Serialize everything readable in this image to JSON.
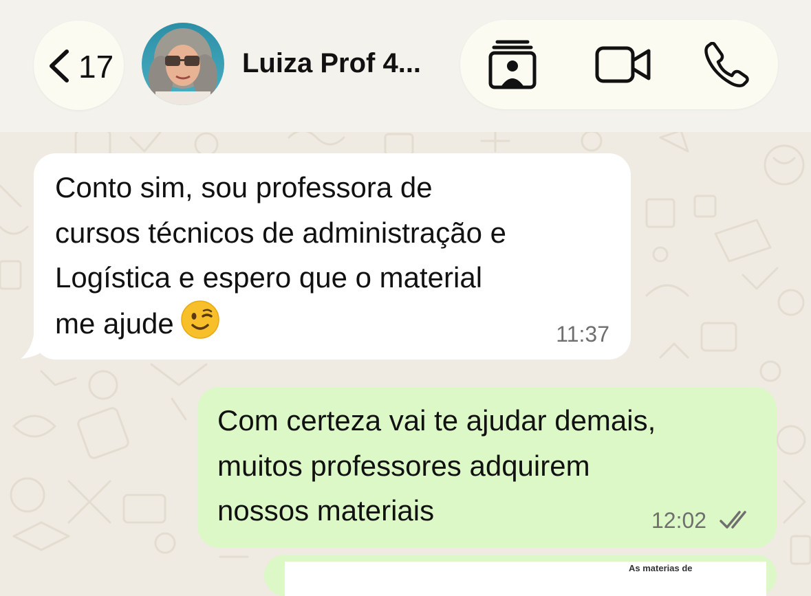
{
  "header": {
    "back_count": "17",
    "contact_name": "Luiza Prof 4...",
    "icons": {
      "back": "chevron-left-icon",
      "contact_card": "contact-card-icon",
      "video_call": "video-camera-icon",
      "voice_call": "phone-icon"
    }
  },
  "messages": [
    {
      "direction": "incoming",
      "text": "Conto sim, sou professora de\ncursos técnicos de administração e\nLogística e espero que o material\nme ajude",
      "emoji": "winking-face-emoji",
      "time": "11:37"
    },
    {
      "direction": "outgoing",
      "text": "Com certeza vai te ajudar demais,\nmuitos professores adquirem\nnossos materiais",
      "time": "12:02",
      "status_icon": "double-check-icon"
    },
    {
      "direction": "outgoing",
      "partial_caption": "As materias de"
    }
  ],
  "colors": {
    "header_bg": "#f3f2ed",
    "pill_bg": "#fbfbf2",
    "chat_bg": "#efeae2",
    "incoming_bubble": "#ffffff",
    "outgoing_bubble": "#dcf8c6",
    "timestamp": "#6f6f6f"
  }
}
